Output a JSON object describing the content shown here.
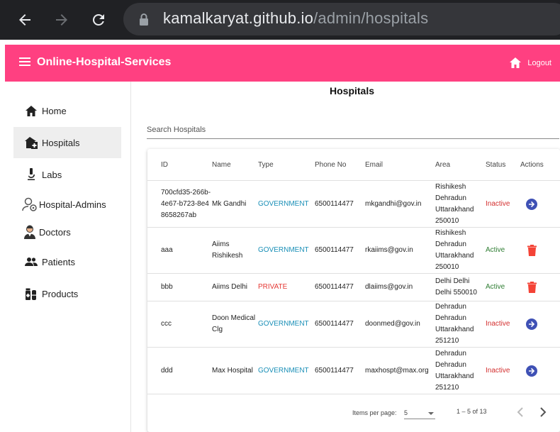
{
  "browser": {
    "url_host": "kamalkaryat.github.io",
    "url_path": "/admin/hospitals"
  },
  "appbar": {
    "brand": "Online-Hospital-Services",
    "logout_label": "Logout",
    "color": "#ff4081"
  },
  "sidebar": {
    "items": [
      {
        "label": "Home",
        "icon": "home-icon"
      },
      {
        "label": "Hospitals",
        "icon": "hospital-icon"
      },
      {
        "label": "Labs",
        "icon": "microscope-icon"
      },
      {
        "label": "Hospital-Admins",
        "icon": "admin-user-icon"
      },
      {
        "label": "Doctors",
        "icon": "doctor-icon"
      },
      {
        "label": "Patients",
        "icon": "people-icon"
      },
      {
        "label": "Products",
        "icon": "medicine-icon"
      }
    ]
  },
  "main": {
    "title": "Hospitals",
    "search_placeholder": "Search Hospitals",
    "columns": [
      "ID",
      "Name",
      "Type",
      "Phone No",
      "Email",
      "Area",
      "Status",
      "Actions"
    ],
    "rows": [
      {
        "id": "700cfd35-266b-4e67-b723-8e48658267ab",
        "name": "Mk Gandhi",
        "type": "GOVERNMENT",
        "phone": "6500114477",
        "email": "mkgandhi@gov.in",
        "area": "Rishikesh Dehradun Uttarakhand 250010",
        "status": "Inactive",
        "action": "arrow-right-circle-icon"
      },
      {
        "id": "aaa",
        "name": "Aiims Rishikesh",
        "type": "GOVERNMENT",
        "phone": "6500114477",
        "email": "rkaiims@gov.in",
        "area": "Rishikesh Dehradun Uttarakhand 250010",
        "status": "Active",
        "action": "trash-icon"
      },
      {
        "id": "bbb",
        "name": "Aiims Delhi",
        "type": "PRIVATE",
        "phone": "6500114477",
        "email": "dlaiims@gov.in",
        "area": "Delhi Delhi Delhi 550010",
        "status": "Active",
        "action": "trash-icon"
      },
      {
        "id": "ccc",
        "name": "Doon Medical Clg",
        "type": "GOVERNMENT",
        "phone": "6500114477",
        "email": "doonmed@gov.in",
        "area": "Dehradun Dehradun Uttarakhand 251210",
        "status": "Inactive",
        "action": "arrow-right-circle-icon"
      },
      {
        "id": "ddd",
        "name": "Max Hospital",
        "type": "GOVERNMENT",
        "phone": "6500114477",
        "email": "maxhospt@max.org",
        "area": "Dehradun Dehradun Uttarakhand 251210",
        "status": "Inactive",
        "action": "arrow-right-circle-icon"
      }
    ],
    "paginator": {
      "items_per_page_label": "Items per page:",
      "page_size": "5",
      "range": "1 – 5 of 13"
    }
  }
}
